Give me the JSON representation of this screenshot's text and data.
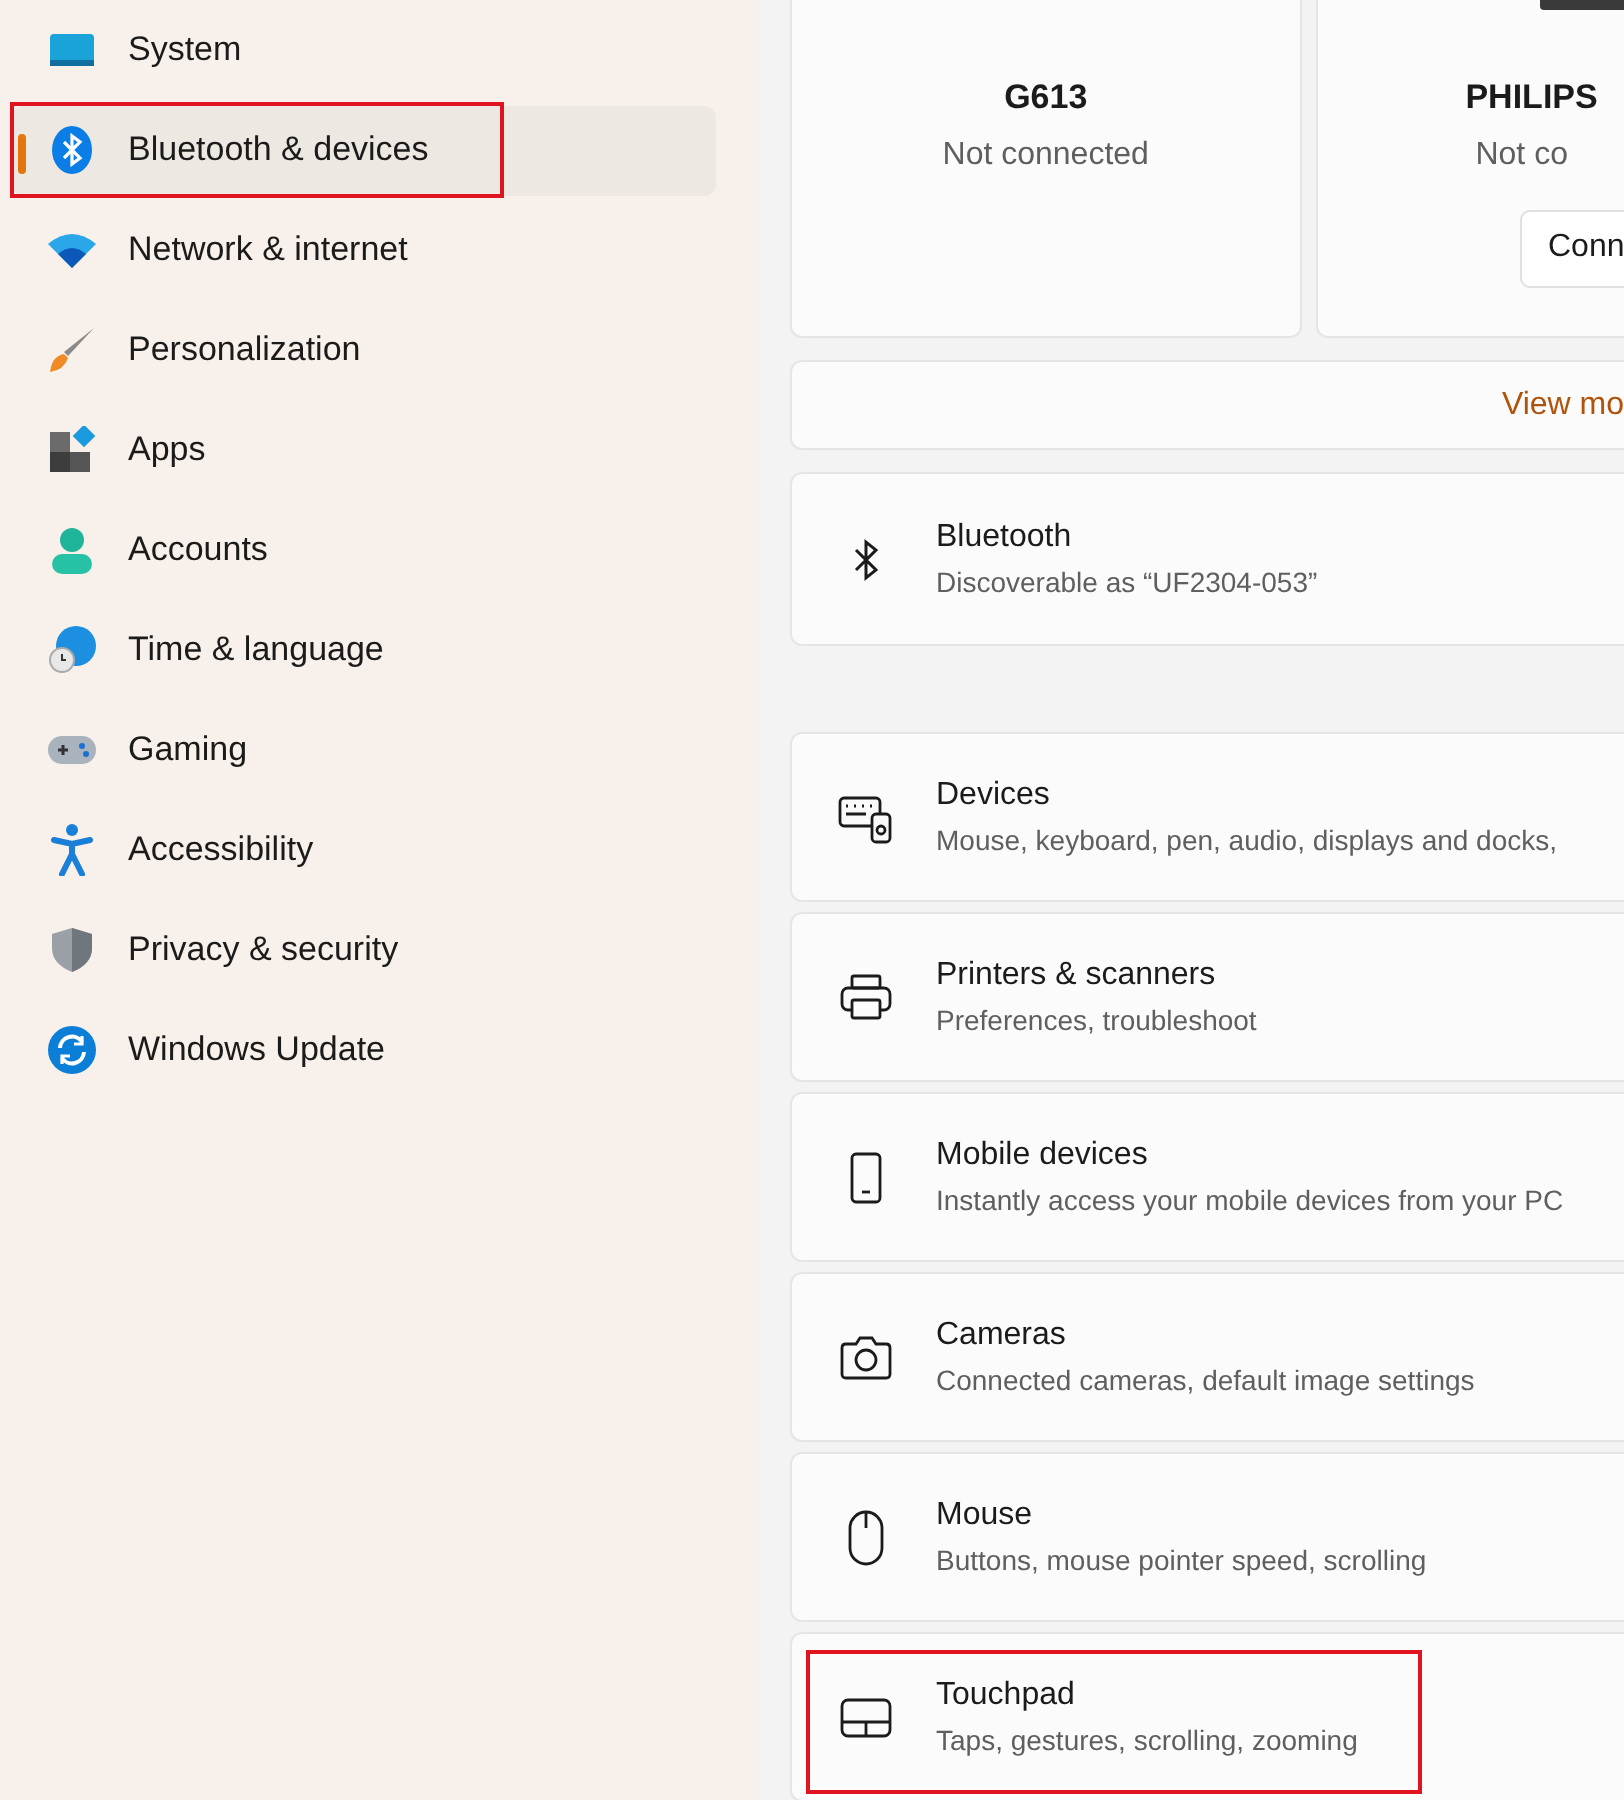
{
  "sidebar": {
    "items": [
      {
        "label": "System",
        "kind": "system",
        "selected": false,
        "highlighted": false
      },
      {
        "label": "Bluetooth & devices",
        "kind": "bluetooth",
        "selected": true,
        "highlighted": true
      },
      {
        "label": "Network & internet",
        "kind": "network",
        "selected": false,
        "highlighted": false
      },
      {
        "label": "Personalization",
        "kind": "brush",
        "selected": false,
        "highlighted": false
      },
      {
        "label": "Apps",
        "kind": "apps",
        "selected": false,
        "highlighted": false
      },
      {
        "label": "Accounts",
        "kind": "person",
        "selected": false,
        "highlighted": false
      },
      {
        "label": "Time & language",
        "kind": "globe",
        "selected": false,
        "highlighted": false
      },
      {
        "label": "Gaming",
        "kind": "gamepad",
        "selected": false,
        "highlighted": false
      },
      {
        "label": "Accessibility",
        "kind": "accessibility",
        "selected": false,
        "highlighted": false
      },
      {
        "label": "Privacy & security",
        "kind": "shield",
        "selected": false,
        "highlighted": false
      },
      {
        "label": "Windows Update",
        "kind": "update",
        "selected": false,
        "highlighted": false
      }
    ]
  },
  "devices": [
    {
      "name": "G613",
      "status": "Not connected"
    },
    {
      "name": "PHILIPS",
      "status": "Not co",
      "button": "Conn"
    }
  ],
  "view_more": "View mo",
  "bluetooth": {
    "title": "Bluetooth",
    "subtitle": "Discoverable as “UF2304-053”"
  },
  "settings": [
    {
      "title": "Devices",
      "subtitle": "Mouse, keyboard, pen, audio, displays and docks,",
      "kind": "devices",
      "highlighted": false
    },
    {
      "title": "Printers & scanners",
      "subtitle": "Preferences, troubleshoot",
      "kind": "printer",
      "highlighted": false
    },
    {
      "title": "Mobile devices",
      "subtitle": "Instantly access your mobile devices from your PC",
      "kind": "phone",
      "highlighted": false
    },
    {
      "title": "Cameras",
      "subtitle": "Connected cameras, default image settings",
      "kind": "camera",
      "highlighted": false
    },
    {
      "title": "Mouse",
      "subtitle": "Buttons, mouse pointer speed, scrolling",
      "kind": "mouse",
      "highlighted": false
    },
    {
      "title": "Touchpad",
      "subtitle": "Taps, gestures, scrolling, zooming",
      "kind": "touchpad",
      "highlighted": true
    }
  ]
}
